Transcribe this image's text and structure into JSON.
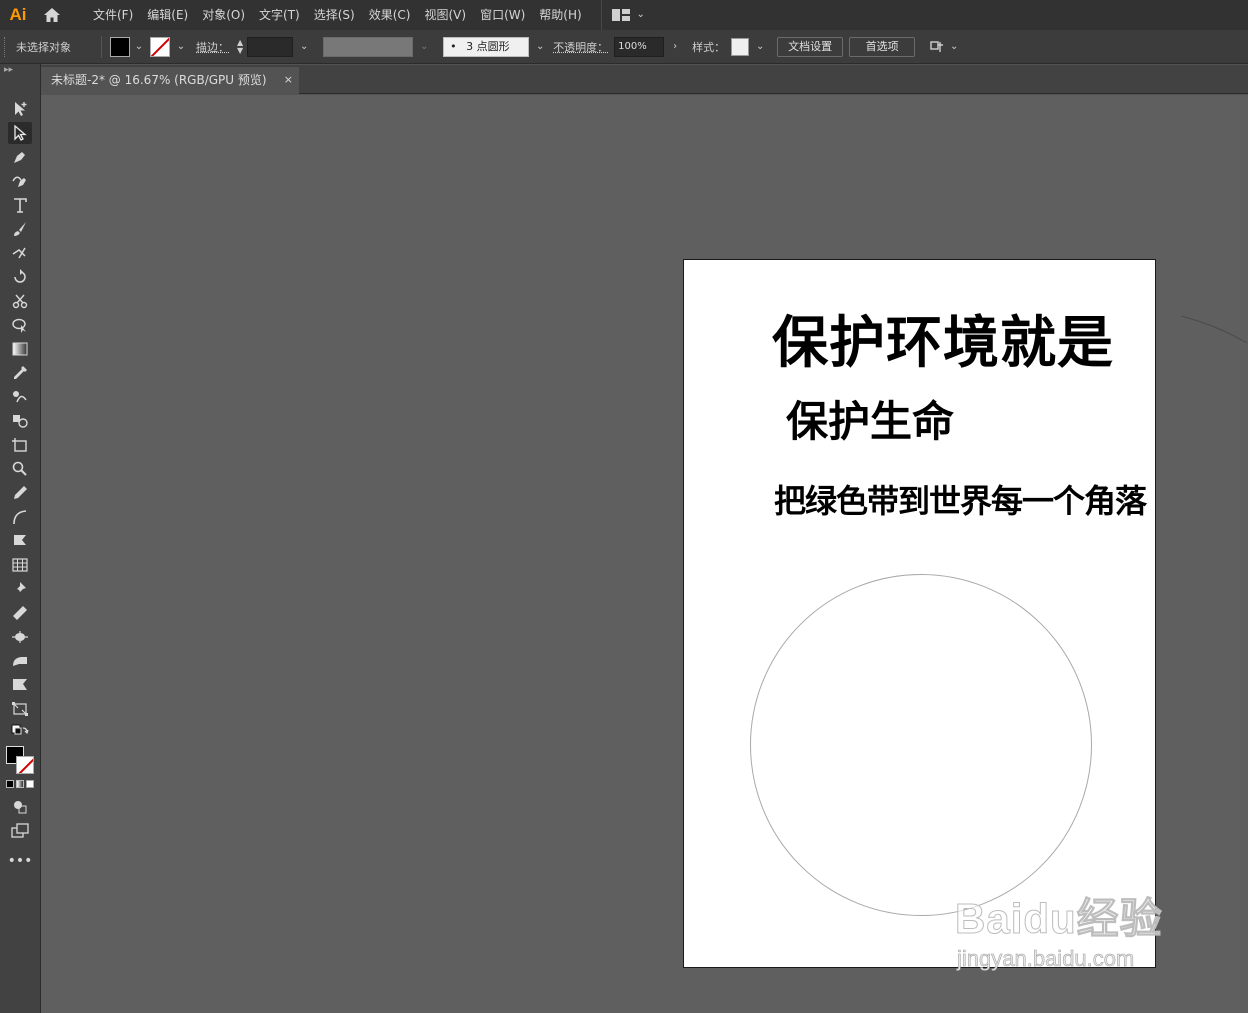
{
  "app": {
    "logo": "Ai"
  },
  "menubar": {
    "items": [
      "文件(F)",
      "编辑(E)",
      "对象(O)",
      "文字(T)",
      "选择(S)",
      "效果(C)",
      "视图(V)",
      "窗口(W)",
      "帮助(H)"
    ]
  },
  "controlbar": {
    "selection_status": "未选择对象",
    "stroke_label": "描边：",
    "brush_value": "3 点圆形",
    "opacity_label": "不透明度：",
    "opacity_value": "100%",
    "style_label": "样式：",
    "doc_settings": "文档设置",
    "preferences": "首选项"
  },
  "tab": {
    "title": "未标题-2* @ 16.67% (RGB/GPU 预览)",
    "close": "×"
  },
  "artboard": {
    "headline": "保护环境就是",
    "subheadline": "保护生命",
    "tagline": "把绿色带到世界每一个角落"
  },
  "watermark": {
    "main": "Baidu经验",
    "sub": "jingyan.baidu.com"
  },
  "colors": {
    "accent_logo": "#ff9a00",
    "canvas": "#5f5f5f",
    "panel": "#424242",
    "menubar": "#323232"
  }
}
